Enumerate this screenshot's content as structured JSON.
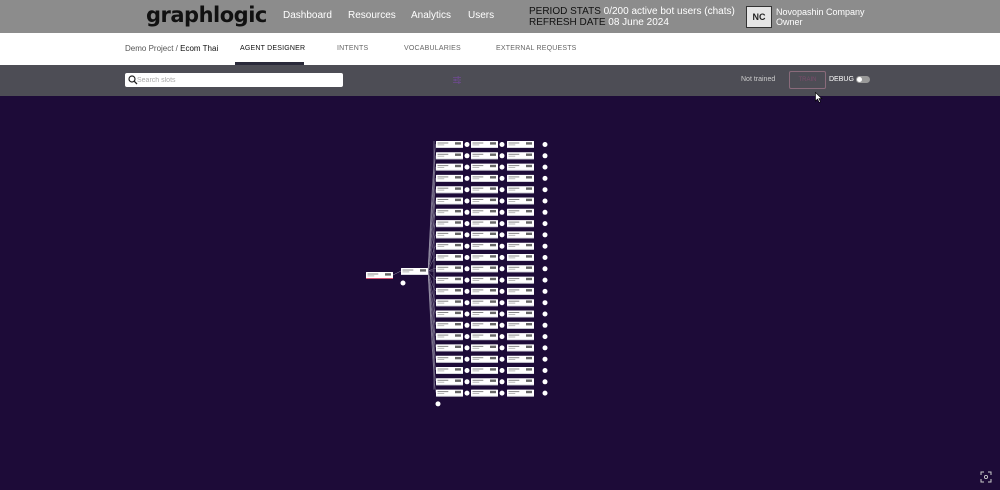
{
  "app": {
    "logo": "graphlogic"
  },
  "nav": {
    "items": [
      "Dashboard",
      "Resources",
      "Analytics",
      "Users"
    ]
  },
  "stats": {
    "period_label": "PERIOD STATS",
    "period_value": "0/200 active bot users (chats)",
    "refresh_label": "REFRESH DATE",
    "refresh_value": "08 June 2024"
  },
  "user": {
    "initials": "NC",
    "company": "Novopashin Company",
    "role": "Owner"
  },
  "breadcrumb": {
    "project": "Demo Project /",
    "current": "Ecom Thai"
  },
  "tabs": [
    "AGENT DESIGNER",
    "INTENTS",
    "VOCABULARIES",
    "EXTERNAL REQUESTS"
  ],
  "toolbar": {
    "search_placeholder": "Search slots",
    "status": "Not trained",
    "train_label": "TRAIN",
    "debug_label": "DEBUG"
  },
  "colors": {
    "canvas_bg": "#1d0b38",
    "node_bg": "#ffffff",
    "edge": "#9a96aa",
    "node_accent": "#c7254e"
  },
  "icons": [
    "search-icon",
    "filter-sliders-icon",
    "toggle-switch",
    "cursor-icon",
    "fit-view-icon"
  ]
}
